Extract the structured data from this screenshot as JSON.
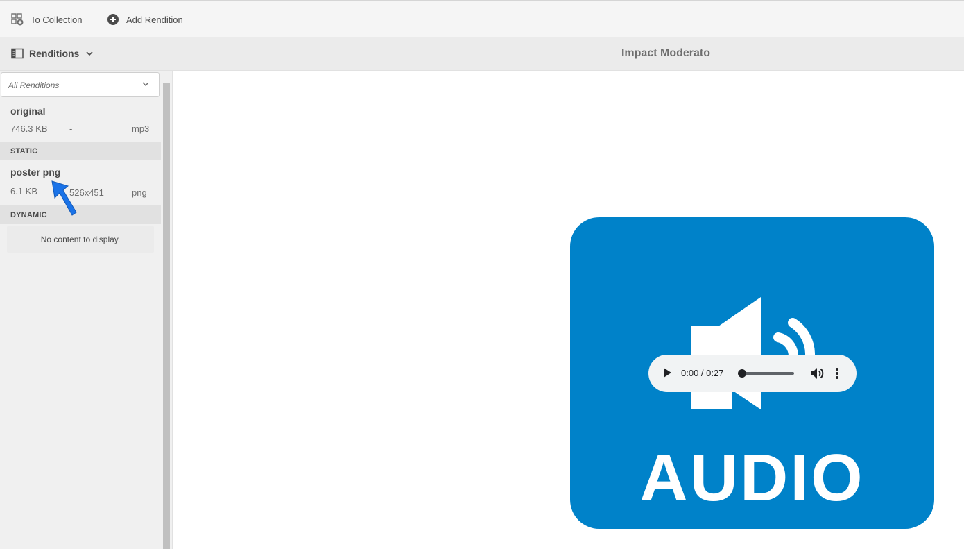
{
  "toolbar": {
    "to_collection": "To Collection",
    "add_rendition": "Add Rendition"
  },
  "subbar": {
    "rail_label": "Renditions",
    "title": "Impact Moderato"
  },
  "filter": {
    "selected": "All Renditions"
  },
  "renditions": {
    "original": {
      "name": "original",
      "size": "746.3 KB",
      "dimensions": "-",
      "type": "mp3"
    },
    "static_header": "STATIC",
    "poster": {
      "name": "poster png",
      "size": "6.1 KB",
      "dimensions": "526x451",
      "type": "png"
    },
    "dynamic_header": "DYNAMIC",
    "dynamic_empty": "No content to display."
  },
  "preview": {
    "word": "AUDIO",
    "player_time": "0:00 / 0:27",
    "progress": 0
  },
  "colors": {
    "audio_card": "#0082c9",
    "pointer_arrow": "#1a73e8"
  }
}
